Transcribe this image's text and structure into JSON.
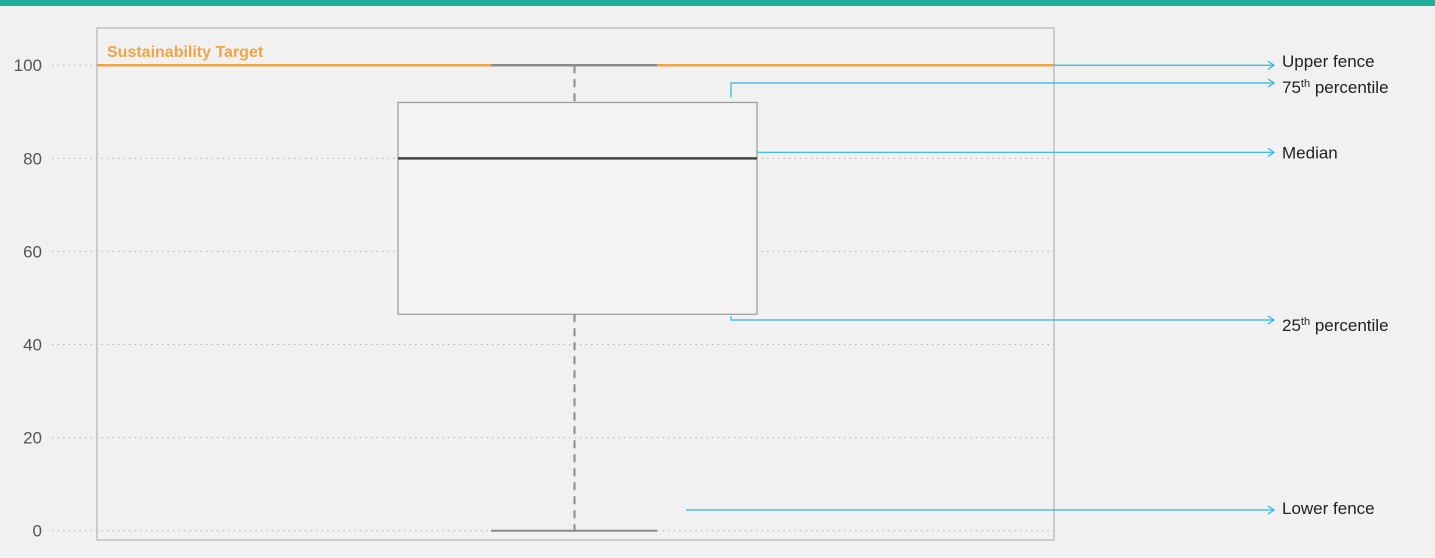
{
  "colors": {
    "top_bar": "#1fb09a",
    "target": "#f0a448",
    "annotation": "#29b6e0",
    "box": "#9a9a9a",
    "median": "#444444",
    "grid": "#b5b5b5"
  },
  "chart_data": {
    "type": "box",
    "title": "",
    "xlabel": "",
    "ylabel": "",
    "ylim": [
      -2,
      108
    ],
    "yticks": [
      0,
      20,
      40,
      60,
      80,
      100
    ],
    "grid": true,
    "box": {
      "lower_fence": 0,
      "q1": 46.5,
      "median": 80,
      "q3": 92,
      "upper_fence": 100
    },
    "target": {
      "label": "Sustainability Target",
      "value": 100
    },
    "annotations": [
      {
        "key": "upper_fence",
        "text": "Upper fence",
        "sup": ""
      },
      {
        "key": "q3",
        "text": "75",
        "sup": "th",
        "suffix": " percentile"
      },
      {
        "key": "median",
        "text": "Median",
        "sup": ""
      },
      {
        "key": "q1",
        "text": "25",
        "sup": "th",
        "suffix": " percentile"
      },
      {
        "key": "lower_fence",
        "text": "Lower fence",
        "sup": ""
      }
    ]
  }
}
